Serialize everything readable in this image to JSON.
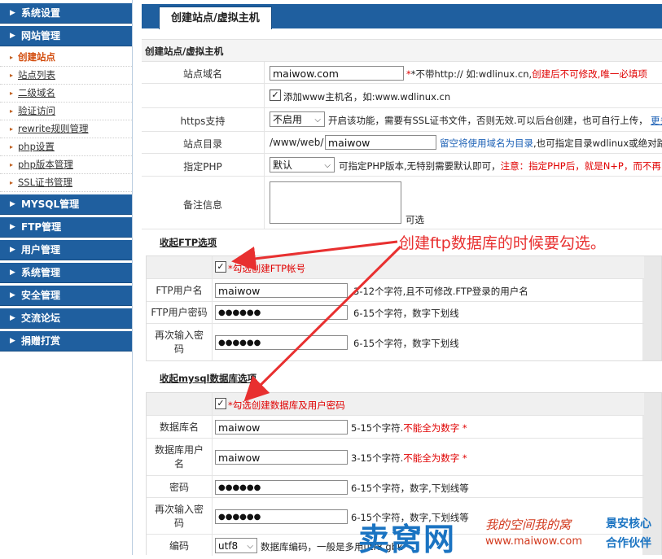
{
  "sidebar": {
    "groups_top": [
      {
        "label": "系统设置"
      },
      {
        "label": "网站管理"
      }
    ],
    "sub_items": [
      {
        "label": "创建站点"
      },
      {
        "label": "站点列表"
      },
      {
        "label": "二级域名"
      },
      {
        "label": "验证访问"
      },
      {
        "label": "rewrite规则管理"
      },
      {
        "label": "php设置"
      },
      {
        "label": "php版本管理"
      },
      {
        "label": "SSL证书管理"
      }
    ],
    "groups_bottom": [
      {
        "label": "MYSQL管理"
      },
      {
        "label": "FTP管理"
      },
      {
        "label": "用户管理"
      },
      {
        "label": "系统管理"
      },
      {
        "label": "安全管理"
      },
      {
        "label": "交流论坛"
      },
      {
        "label": "捐赠打赏"
      }
    ]
  },
  "main": {
    "tab_label": "创建站点/虚拟主机",
    "section_title": "创建站点/虚拟主机",
    "site_domain": {
      "label": "站点域名",
      "value": "maiwow.com",
      "hint_black": "*不带http:// 如:wdlinux.cn,",
      "hint_red": "创建后不可修改,唯一必填项"
    },
    "add_www": {
      "checked": "✓",
      "text": "添加www主机名，如:www.wdlinux.cn"
    },
    "https": {
      "label": "https支持",
      "selected": "不启用",
      "hint": "开启该功能，需要有SSL证书文件，否则无效.可以后台创建，也可自行上传，",
      "link": "更多"
    },
    "site_dir": {
      "label": "站点目录",
      "prefix": "/www/web/",
      "value": "maiwow",
      "hint_blue": "留空将使用域名为目录",
      "hint_black": ",也可指定目录wdlinux或绝对路"
    },
    "php": {
      "label": "指定PHP",
      "selected": "默认",
      "hint_black": "可指定PHP版本,无特别需要默认即可，",
      "hint_red": "注意：指定PHP后，就是N+P，而不再"
    },
    "remark": {
      "label": "备注信息",
      "optional": "可选"
    },
    "ftp": {
      "toggle": "收起FTP选项",
      "check_text": "*勾选创建FTP帐号",
      "checked": "✓",
      "user_label": "FTP用户名",
      "user_value": "maiwow",
      "user_hint": "3-12个字符,且不可修改.FTP登录的用户名",
      "pass_label": "FTP用户密码",
      "pass_value": "●●●●●●",
      "pass_hint": "6-15个字符，数字下划线",
      "repass_label_1": "再次输入密",
      "repass_label_2": "码",
      "repass_value": "●●●●●●",
      "repass_hint": "6-15个字符，数字下划线"
    },
    "mysql": {
      "toggle": "收起mysql数据库选项",
      "check_text": "*勾选创建数据库及用户密码",
      "checked": "✓",
      "db_label": "数据库名",
      "db_value": "maiwow",
      "db_hint_black": "5-15个字符.",
      "db_hint_red": "不能全为数字 *",
      "user_label_1": "数据库用户",
      "user_label_2": "名",
      "user_value": "maiwow",
      "user_hint_black": "3-15个字符.",
      "user_hint_red": "不能全为数字 *",
      "pass_label": "密码",
      "pass_value": "●●●●●●",
      "pass_hint": "6-15个字符，数字,下划线等",
      "repass_label_1": "再次输入密",
      "repass_label_2": "码",
      "repass_value": "●●●●●●",
      "repass_hint": "6-15个字符，数字,下划线等",
      "charset_label": "编码",
      "charset_value": "utf8",
      "charset_hint": "数据库编码，一般是多用utf8,gbk"
    }
  },
  "annotation": {
    "text": "创建ftp数据库的时候要勾选。",
    "color": "#e83030"
  },
  "watermark": {
    "brand": "卖窝网",
    "script": "我的空间我的窝",
    "url": "www.maiwow.com",
    "partner_1": "景安核心",
    "partner_2": "合作伙伴"
  },
  "colors": {
    "nav_blue": "#1f5f9f",
    "accent_red": "#e00000",
    "link_blue": "#1a5fb5"
  }
}
